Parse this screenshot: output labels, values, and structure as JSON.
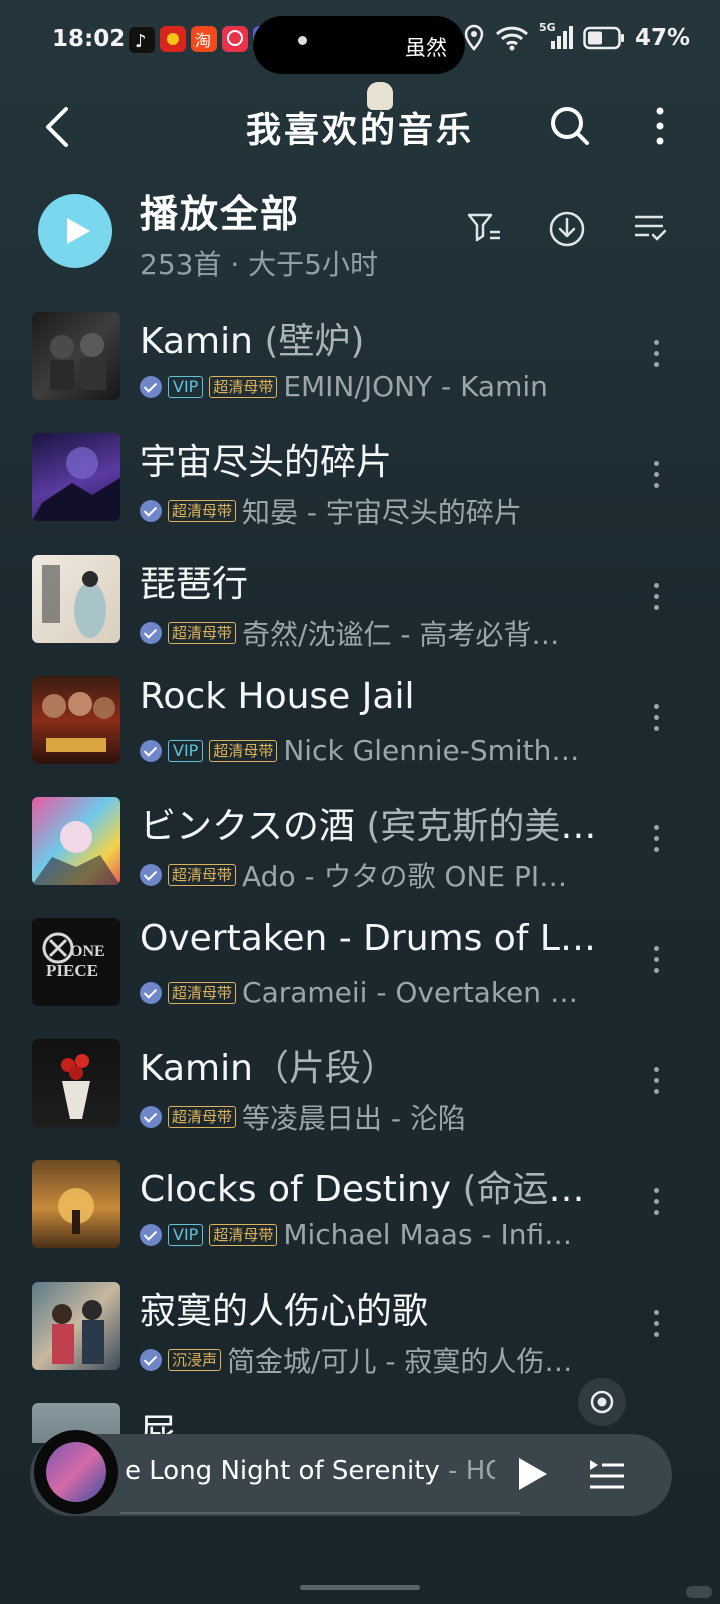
{
  "status_bar": {
    "time": "18:02",
    "island_text": "虽然",
    "network": "5G",
    "battery": "47%",
    "notification_icons": [
      "douyin-icon",
      "red-app-icon",
      "taobao-icon",
      "vip-app-icon",
      "tie-app-icon"
    ]
  },
  "header": {
    "title": "我喜欢的音乐"
  },
  "play_all": {
    "label": "播放全部",
    "summary": "253首 · 大于5小时"
  },
  "songs": [
    {
      "title": "Kamin ",
      "title_extra": "(壁炉)",
      "vip": true,
      "hq": "超清母带",
      "artist": "EMIN/JONY - Kamin",
      "cover": "dark-portraits"
    },
    {
      "title": "宇宙尽头的碎片",
      "title_extra": "",
      "vip": false,
      "hq": "超清母带",
      "artist": "知晏 - 宇宙尽头的碎片",
      "cover": "purple-galaxy"
    },
    {
      "title": "琵琶行",
      "title_extra": "",
      "vip": false,
      "hq": "超清母带",
      "artist": "奇然/沈谧仁 - 高考必背古诗词",
      "cover": "ink-painting"
    },
    {
      "title": "Rock House Jail",
      "title_extra": "",
      "vip": true,
      "hq": "超清母带",
      "artist": "Nick Glennie-Smith - The Rock",
      "cover": "movie-poster"
    },
    {
      "title": "ビンクスの酒 ",
      "title_extra": "(宾克斯的美酒)",
      "vip": false,
      "hq": "超清母带",
      "artist": "Ado - ウタの歌 ONE PIECE FILM RED",
      "cover": "anime-colorful"
    },
    {
      "title": "Overtaken - Drums of Liberation",
      "title_extra": "",
      "vip": false,
      "hq": "超清母带",
      "artist": "Carameii - Overtaken - Drums",
      "cover": "one-piece-logo"
    },
    {
      "title": "Kamin",
      "title_extra": "（片段）",
      "vip": false,
      "hq": "超清母带",
      "artist": "等凌晨日出 - 沦陷",
      "cover": "red-roses"
    },
    {
      "title": "Clocks of Destiny ",
      "title_extra": "(命运之钟)",
      "vip": true,
      "hq": "超清母带",
      "artist": "Michael Maas - Infinite Emotions",
      "cover": "golden-field"
    },
    {
      "title": "寂寞的人伤心的歌",
      "title_extra": "",
      "vip": false,
      "hq": "沉浸声",
      "artist": "简金城/可儿 - 寂寞的人伤心的歌",
      "cover": "couple-portrait"
    },
    {
      "title": "屁",
      "title_extra": "",
      "vip": false,
      "hq": "",
      "artist": "",
      "cover": "partial"
    }
  ],
  "mini_player": {
    "now_playing": "e Long Night of Serenity",
    "artist": " - HOYO-MiX"
  }
}
